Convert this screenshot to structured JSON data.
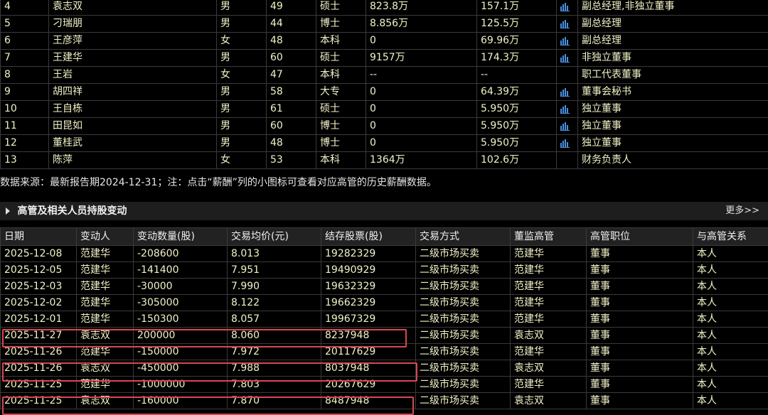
{
  "managers": [
    {
      "no": "4",
      "name": "袁志双",
      "gender": "男",
      "age": "49",
      "edu": "硕士",
      "holding": "823.8万",
      "salary": "157.1万",
      "icon": true,
      "position": "副总经理,非独立董事"
    },
    {
      "no": "5",
      "name": "刁瑞朋",
      "gender": "男",
      "age": "44",
      "edu": "博士",
      "holding": "8.856万",
      "salary": "125.5万",
      "icon": true,
      "position": "副总经理"
    },
    {
      "no": "6",
      "name": "王彦萍",
      "gender": "女",
      "age": "48",
      "edu": "本科",
      "holding": "0",
      "salary": "69.96万",
      "icon": true,
      "position": "副总经理"
    },
    {
      "no": "7",
      "name": "王建华",
      "gender": "男",
      "age": "60",
      "edu": "硕士",
      "holding": "9157万",
      "salary": "174.3万",
      "icon": true,
      "position": "非独立董事"
    },
    {
      "no": "8",
      "name": "王岩",
      "gender": "女",
      "age": "47",
      "edu": "本科",
      "holding": "--",
      "salary": "--",
      "icon": false,
      "position": "职工代表董事"
    },
    {
      "no": "9",
      "name": "胡四祥",
      "gender": "男",
      "age": "58",
      "edu": "大专",
      "holding": "0",
      "salary": "64.39万",
      "icon": true,
      "position": "董事会秘书"
    },
    {
      "no": "10",
      "name": "王自栋",
      "gender": "男",
      "age": "61",
      "edu": "硕士",
      "holding": "0",
      "salary": "5.950万",
      "icon": true,
      "position": "独立董事"
    },
    {
      "no": "11",
      "name": "田昆如",
      "gender": "男",
      "age": "60",
      "edu": "博士",
      "holding": "0",
      "salary": "5.950万",
      "icon": true,
      "position": "独立董事"
    },
    {
      "no": "12",
      "name": "董桂武",
      "gender": "男",
      "age": "48",
      "edu": "博士",
      "holding": "0",
      "salary": "5.950万",
      "icon": true,
      "position": "独立董事"
    },
    {
      "no": "13",
      "name": "陈萍",
      "gender": "女",
      "age": "53",
      "edu": "本科",
      "holding": "1364万",
      "salary": "102.6万",
      "icon": false,
      "position": "财务负责人"
    }
  ],
  "note": "数据来源：最新报告期2024-12-31；注：点击“薪酬”列的小图标可查看对应高管的历史薪酬数据。",
  "section": {
    "title": "高管及相关人员持股变动",
    "more": "更多>>"
  },
  "trade_headers": [
    "日期",
    "变动人",
    "变动数量(股)",
    "交易均价(元)",
    "结存股票(股)",
    "交易方式",
    "董监高管",
    "高管职位",
    "与高管关系"
  ],
  "trades": [
    [
      "2025-12-08",
      "范建华",
      "-208600",
      "8.013",
      "19282329",
      "二级市场买卖",
      "范建华",
      "董事",
      "本人"
    ],
    [
      "2025-12-05",
      "范建华",
      "-141400",
      "7.951",
      "19490929",
      "二级市场买卖",
      "范建华",
      "董事",
      "本人"
    ],
    [
      "2025-12-03",
      "范建华",
      "-30000",
      "7.990",
      "19632329",
      "二级市场买卖",
      "范建华",
      "董事",
      "本人"
    ],
    [
      "2025-12-02",
      "范建华",
      "-305000",
      "8.122",
      "19662329",
      "二级市场买卖",
      "范建华",
      "董事",
      "本人"
    ],
    [
      "2025-12-01",
      "范建华",
      "-150300",
      "8.057",
      "19967329",
      "二级市场买卖",
      "范建华",
      "董事",
      "本人"
    ],
    [
      "2025-11-27",
      "袁志双",
      "200000",
      "8.060",
      "8237948",
      "二级市场买卖",
      "袁志双",
      "董事",
      "本人"
    ],
    [
      "2025-11-26",
      "范建华",
      "-150000",
      "7.972",
      "20117629",
      "二级市场买卖",
      "范建华",
      "董事",
      "本人"
    ],
    [
      "2025-11-26",
      "袁志双",
      "-450000",
      "7.988",
      "8037948",
      "二级市场买卖",
      "袁志双",
      "董事",
      "本人"
    ],
    [
      "2025-11-25",
      "范建华",
      "-1000000",
      "7.803",
      "20267629",
      "二级市场买卖",
      "范建华",
      "董事",
      "本人"
    ],
    [
      "2025-11-25",
      "袁志双",
      "-160000",
      "7.870",
      "8487948",
      "二级市场买卖",
      "袁志双",
      "董事",
      "本人"
    ]
  ],
  "colors": {
    "highlight": "#d9474f",
    "text": "#f2f2c8",
    "icon": "#4a8fe0"
  },
  "icon_name": "bar-chart-icon"
}
